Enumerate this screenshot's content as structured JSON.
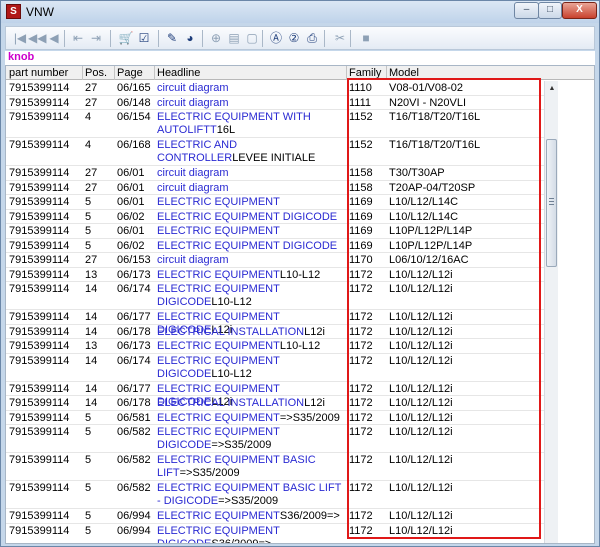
{
  "window": {
    "title": "VNW",
    "app_icon": "vnw-app-icon"
  },
  "title_buttons": {
    "minimize": "–",
    "maximize": "□",
    "close": "X"
  },
  "toolbar": [
    {
      "icon": "first-page-icon",
      "glyph": "|◀",
      "enabled": false
    },
    {
      "icon": "rewind-icon",
      "glyph": "◀◀",
      "enabled": false
    },
    {
      "icon": "previous-icon",
      "glyph": "◀",
      "enabled": false
    },
    {
      "icon": "skip-back-icon",
      "glyph": "⇤",
      "enabled": false
    },
    {
      "icon": "forward-back-icon",
      "glyph": "⇥",
      "enabled": false
    },
    {
      "icon": "cart-icon",
      "glyph": "🛒",
      "enabled": true
    },
    {
      "icon": "checklist-icon",
      "glyph": "☑",
      "enabled": true
    },
    {
      "icon": "pencil-icon",
      "glyph": "✎",
      "enabled": true
    },
    {
      "icon": "globe-icon",
      "glyph": "◕",
      "enabled": true
    },
    {
      "icon": "zoom-icon",
      "glyph": "⊕",
      "enabled": false
    },
    {
      "icon": "document-icon",
      "glyph": "▤",
      "enabled": false
    },
    {
      "icon": "page-icon",
      "glyph": "▢",
      "enabled": false
    },
    {
      "icon": "circle-a-icon",
      "glyph": "Ⓐ",
      "enabled": true
    },
    {
      "icon": "circle-2-icon",
      "glyph": "②",
      "enabled": true
    },
    {
      "icon": "printer-icon",
      "glyph": "⎙",
      "enabled": true
    },
    {
      "icon": "tool-icon",
      "glyph": "✂",
      "enabled": false
    },
    {
      "icon": "stop-icon",
      "glyph": "■",
      "enabled": false
    }
  ],
  "filter": {
    "text": "knob"
  },
  "columns": [
    "part number",
    "Pos.",
    "Page",
    "Headline",
    "Family",
    "Model"
  ],
  "rows": [
    {
      "part": "7915399114",
      "pos": "27",
      "page": "06/165",
      "headline": "circuit diagram",
      "suffix": "",
      "family": "1110",
      "model": "V08-01/V08-02",
      "lines": 1
    },
    {
      "part": "7915399114",
      "pos": "27",
      "page": "06/148",
      "headline": "circuit diagram",
      "suffix": "",
      "family": "1111",
      "model": "N20VI - N20VLI",
      "lines": 1
    },
    {
      "part": "7915399114",
      "pos": "4",
      "page": "06/154",
      "headline": "ELECTRIC EQUIPMENT WITH AUTOLIFTT",
      "suffix": "16L",
      "family": "1152",
      "model": "T16/T18/T20/T16L",
      "lines": 2
    },
    {
      "part": "7915399114",
      "pos": "4",
      "page": "06/168",
      "headline": "ELECTRIC AND CONTROLLER",
      "suffix": "LEVEE INITIALE",
      "family": "1152",
      "model": "T16/T18/T20/T16L",
      "lines": 2
    },
    {
      "part": "7915399114",
      "pos": "27",
      "page": "06/01",
      "headline": "circuit diagram",
      "suffix": "",
      "family": "1158",
      "model": "T30/T30AP",
      "lines": 1
    },
    {
      "part": "7915399114",
      "pos": "27",
      "page": "06/01",
      "headline": "circuit diagram",
      "suffix": "",
      "family": "1158",
      "model": "T20AP-04/T20SP",
      "lines": 1
    },
    {
      "part": "7915399114",
      "pos": "5",
      "page": "06/01",
      "headline": "ELECTRIC EQUIPMENT",
      "suffix": "",
      "family": "1169",
      "model": "L10/L12/L14C",
      "lines": 1
    },
    {
      "part": "7915399114",
      "pos": "5",
      "page": "06/02",
      "headline": "ELECTRIC EQUIPMENT DIGICODE",
      "suffix": "",
      "family": "1169",
      "model": "L10/L12/L14C",
      "lines": 1
    },
    {
      "part": "7915399114",
      "pos": "5",
      "page": "06/01",
      "headline": "ELECTRIC EQUIPMENT",
      "suffix": "",
      "family": "1169",
      "model": "L10P/L12P/L14P",
      "lines": 1
    },
    {
      "part": "7915399114",
      "pos": "5",
      "page": "06/02",
      "headline": "ELECTRIC EQUIPMENT DIGICODE",
      "suffix": "",
      "family": "1169",
      "model": "L10P/L12P/L14P",
      "lines": 1
    },
    {
      "part": "7915399114",
      "pos": "27",
      "page": "06/153",
      "headline": "circuit diagram",
      "suffix": "",
      "family": "1170",
      "model": "L06/10/12/16AC",
      "lines": 1
    },
    {
      "part": "7915399114",
      "pos": "13",
      "page": "06/173",
      "headline": "ELECTRIC EQUIPMENT",
      "suffix": "L10-L12",
      "family": "1172",
      "model": "L10/L12/L12i",
      "lines": 1
    },
    {
      "part": "7915399114",
      "pos": "14",
      "page": "06/174",
      "headline": "ELECTRIC EQUIPMENT DIGICODE",
      "suffix": "L10-L12",
      "family": "1172",
      "model": "L10/L12/L12i",
      "lines": 2
    },
    {
      "part": "7915399114",
      "pos": "14",
      "page": "06/177",
      "headline": "ELECTRIC EQUIPMENT DIGICODE",
      "suffix": "L12i",
      "family": "1172",
      "model": "L10/L12/L12i",
      "lines": 1
    },
    {
      "part": "7915399114",
      "pos": "14",
      "page": "06/178",
      "headline": "ELECTRICAL INSTALLATION",
      "suffix": "L12i",
      "family": "1172",
      "model": "L10/L12/L12i",
      "lines": 1
    },
    {
      "part": "7915399114",
      "pos": "13",
      "page": "06/173",
      "headline": "ELECTRIC EQUIPMENT",
      "suffix": "L10-L12",
      "family": "1172",
      "model": "L10/L12/L12i",
      "lines": 1
    },
    {
      "part": "7915399114",
      "pos": "14",
      "page": "06/174",
      "headline": "ELECTRIC EQUIPMENT DIGICODE",
      "suffix": "L10-L12",
      "family": "1172",
      "model": "L10/L12/L12i",
      "lines": 2
    },
    {
      "part": "7915399114",
      "pos": "14",
      "page": "06/177",
      "headline": "ELECTRIC EQUIPMENT DIGICODE",
      "suffix": "L12i",
      "family": "1172",
      "model": "L10/L12/L12i",
      "lines": 1
    },
    {
      "part": "7915399114",
      "pos": "14",
      "page": "06/178",
      "headline": "ELECTRICAL INSTALLATION",
      "suffix": "L12i",
      "family": "1172",
      "model": "L10/L12/L12i",
      "lines": 1
    },
    {
      "part": "7915399114",
      "pos": "5",
      "page": "06/581",
      "headline": "ELECTRIC EQUIPMENT",
      "suffix": "=>S35/2009",
      "family": "1172",
      "model": "L10/L12/L12i",
      "lines": 1
    },
    {
      "part": "7915399114",
      "pos": "5",
      "page": "06/582",
      "headline": "ELECTRIC EQUIPMENT DIGICODE",
      "suffix": "=>S35/2009",
      "family": "1172",
      "model": "L10/L12/L12i",
      "lines": 2
    },
    {
      "part": "7915399114",
      "pos": "5",
      "page": "06/582",
      "headline": "ELECTRIC EQUIPMENT BASIC LIFT",
      "suffix": "=>S35/2009",
      "family": "1172",
      "model": "L10/L12/L12i",
      "lines": 2
    },
    {
      "part": "7915399114",
      "pos": "5",
      "page": "06/582",
      "headline": "ELECTRIC EQUIPMENT BASIC LIFT - DIGICODE",
      "suffix": "=>S35/2009",
      "family": "1172",
      "model": "L10/L12/L12i",
      "lines": 2
    },
    {
      "part": "7915399114",
      "pos": "5",
      "page": "06/994",
      "headline": "ELECTRIC EQUIPMENT",
      "suffix": "S36/2009=>",
      "family": "1172",
      "model": "L10/L12/L12i",
      "lines": 1
    },
    {
      "part": "7915399114",
      "pos": "5",
      "page": "06/994",
      "headline": "ELECTRIC EQUIPMENT DIGICODE",
      "suffix": "S36/2009=>",
      "family": "1172",
      "model": "L10/L12/L12i",
      "lines": 2
    }
  ],
  "colors": {
    "headline": "#2a2ad2",
    "filter": "#cc00cc",
    "highlight": "#e01818"
  }
}
